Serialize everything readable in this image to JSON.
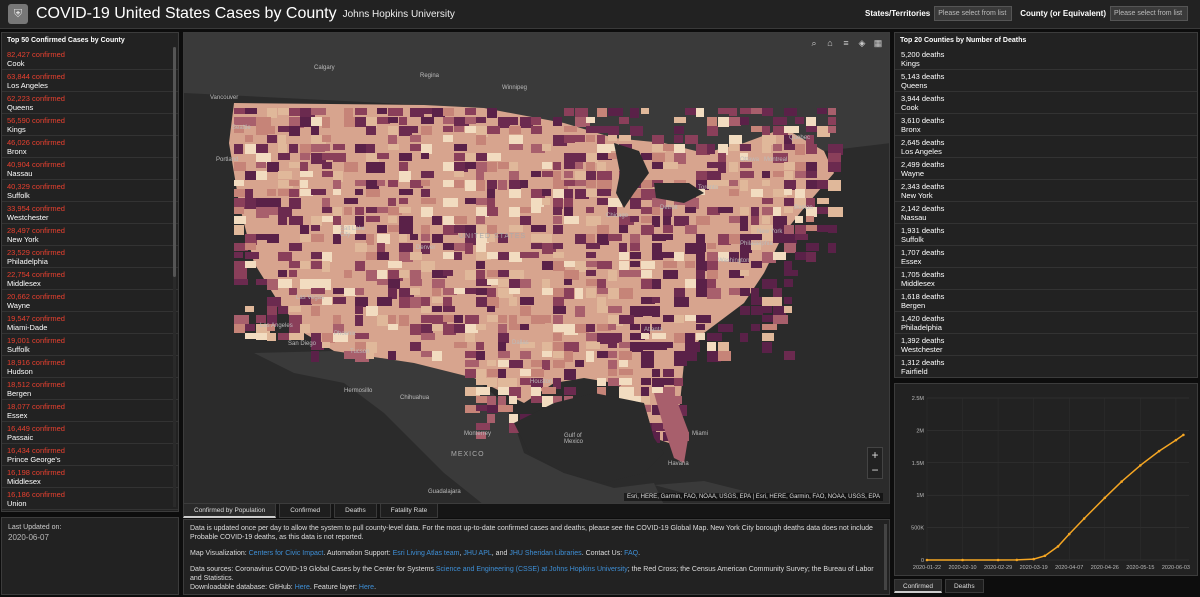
{
  "header": {
    "title": "COVID-19 United States Cases by County",
    "subtitle": "Johns Hopkins University",
    "states_label": "States/Territories",
    "states_placeholder": "Please select from list",
    "county_label": "County (or Equivalent)",
    "county_placeholder": "Please select from list"
  },
  "left_panel": {
    "heading": "Top 50 Confirmed Cases by County",
    "items": [
      {
        "value": "82,427 confirmed",
        "name": "Cook"
      },
      {
        "value": "63,844 confirmed",
        "name": "Los Angeles"
      },
      {
        "value": "62,223 confirmed",
        "name": "Queens"
      },
      {
        "value": "56,590 confirmed",
        "name": "Kings"
      },
      {
        "value": "46,026 confirmed",
        "name": "Bronx"
      },
      {
        "value": "40,904 confirmed",
        "name": "Nassau"
      },
      {
        "value": "40,329 confirmed",
        "name": "Suffolk"
      },
      {
        "value": "33,954 confirmed",
        "name": "Westchester"
      },
      {
        "value": "28,497 confirmed",
        "name": "New York"
      },
      {
        "value": "23,529 confirmed",
        "name": "Philadelphia"
      },
      {
        "value": "22,754 confirmed",
        "name": "Middlesex"
      },
      {
        "value": "20,662 confirmed",
        "name": "Wayne"
      },
      {
        "value": "19,547 confirmed",
        "name": "Miami-Dade"
      },
      {
        "value": "19,001 confirmed",
        "name": "Suffolk"
      },
      {
        "value": "18,916 confirmed",
        "name": "Hudson"
      },
      {
        "value": "18,512 confirmed",
        "name": "Bergen"
      },
      {
        "value": "18,077 confirmed",
        "name": "Essex"
      },
      {
        "value": "16,449 confirmed",
        "name": "Passaic"
      },
      {
        "value": "16,434 confirmed",
        "name": "Prince George's"
      },
      {
        "value": "16,198 confirmed",
        "name": "Middlesex"
      },
      {
        "value": "16,186 confirmed",
        "name": "Union"
      }
    ]
  },
  "last_updated": {
    "label": "Last Updated on:",
    "value": "2020-06-07"
  },
  "map": {
    "tools": [
      "search-icon",
      "home-icon",
      "list-icon",
      "layers-icon",
      "qr-icon"
    ],
    "zoom_in": "+",
    "zoom_out": "−",
    "attribution": "Esri, HERE, Garmin, FAO, NOAA, USGS, EPA | Esri, HERE, Garmin, FAO, NOAA, USGS, EPA",
    "labels": {
      "united_states": "UNITED STATES",
      "mexico": "MEXICO",
      "gulf": "Gulf of Mexico",
      "calgary": "Calgary",
      "regina": "Regina",
      "winnipeg": "Winnipeg",
      "vancouver": "Vancouver",
      "seattle": "Seattle",
      "portland": "Portland",
      "montreal": "Montreal",
      "ottawa": "Ottawa",
      "toronto": "Toronto",
      "boston": "Boston",
      "new_york": "New York",
      "chicago": "Chicago",
      "detroit": "Detroit",
      "denver": "Denver",
      "salt_lake": "Salt Lake City",
      "las_vegas": "Las Vegas",
      "los_angeles": "Los Angeles",
      "san_diego": "San Diego",
      "phoenix": "Phoenix",
      "tucson": "Tucson",
      "dallas": "Dallas",
      "houston": "Houston",
      "atlanta": "Atlanta",
      "miami": "Miami",
      "havana": "Havana",
      "monterrey": "Monterrey",
      "washington": "Washington",
      "philadelphia": "Philadelphia",
      "quebec": "Quebec",
      "hermosillo": "Hermosillo",
      "chihuahua": "Chihuahua",
      "guadalajara": "Guadalajara"
    },
    "tabs": [
      "Confirmed by Population",
      "Confirmed",
      "Deaths",
      "Fatality Rate"
    ]
  },
  "info": {
    "p1": "Data is updated once per day to allow the system to pull county-level data. For the most up-to-date confirmed cases and deaths, please see the COVID-19 Global Map. New York City borough deaths data does not include Probable COVID-19 deaths, as this data is not reported.",
    "p2_prefix": "Map Visualization: ",
    "p2_link1": "Centers for Civic Impact",
    "p2_mid1": ". Automation Support: ",
    "p2_link2": "Esri Living Atlas team",
    "p2_sep": ", ",
    "p2_link3": "JHU APL",
    "p2_mid2": ", and ",
    "p2_link4": "JHU Sheridan Libraries",
    "p2_mid3": ". Contact Us: ",
    "p2_link5": "FAQ",
    "p2_end": ".",
    "p3_prefix": "Data sources: Coronavirus COVID-19 Global Cases by the Center for Systems ",
    "p3_link": "Science and Engineering (CSSE) at Johns Hopkins University",
    "p3_rest": "; the Red Cross; the Census American Community Survey; the Bureau of Labor and Statistics.",
    "p4_prefix": "Downloadable database: GitHub: ",
    "p4_link1": "Here",
    "p4_mid": ". Feature layer: ",
    "p4_link2": "Here",
    "p4_end": "."
  },
  "right_panel": {
    "heading": "Top 20 Counties by Number of Deaths",
    "items": [
      {
        "value": "5,200 deaths",
        "name": "Kings"
      },
      {
        "value": "5,143 deaths",
        "name": "Queens"
      },
      {
        "value": "3,944 deaths",
        "name": "Cook"
      },
      {
        "value": "3,610 deaths",
        "name": "Bronx"
      },
      {
        "value": "2,645 deaths",
        "name": "Los Angeles"
      },
      {
        "value": "2,499 deaths",
        "name": "Wayne"
      },
      {
        "value": "2,343 deaths",
        "name": "New York"
      },
      {
        "value": "2,142 deaths",
        "name": "Nassau"
      },
      {
        "value": "1,931 deaths",
        "name": "Suffolk"
      },
      {
        "value": "1,707 deaths",
        "name": "Essex"
      },
      {
        "value": "1,705 deaths",
        "name": "Middlesex"
      },
      {
        "value": "1,618 deaths",
        "name": "Bergen"
      },
      {
        "value": "1,420 deaths",
        "name": "Philadelphia"
      },
      {
        "value": "1,392 deaths",
        "name": "Westchester"
      },
      {
        "value": "1,312 deaths",
        "name": "Fairfield"
      }
    ]
  },
  "chart_tabs": [
    "Confirmed",
    "Deaths"
  ],
  "colors": {
    "accent_red": "#e8402f",
    "line": "#f5a623",
    "link": "#3e8fd6"
  },
  "chart_data": {
    "type": "line",
    "title": "",
    "xlabel": "",
    "ylabel": "",
    "x_ticks": [
      "2020-01-22",
      "2020-02-10",
      "2020-02-29",
      "2020-03-19",
      "2020-04-07",
      "2020-04-26",
      "2020-05-15",
      "2020-06-03"
    ],
    "y_ticks": [
      "0",
      "500K",
      "1M",
      "1.5M",
      "2M",
      "2.5M"
    ],
    "ylim": [
      0,
      2500000
    ],
    "series": [
      {
        "name": "",
        "x": [
          "2020-01-22",
          "2020-02-10",
          "2020-02-29",
          "2020-03-10",
          "2020-03-19",
          "2020-03-25",
          "2020-04-01",
          "2020-04-07",
          "2020-04-15",
          "2020-04-26",
          "2020-05-05",
          "2020-05-15",
          "2020-05-25",
          "2020-06-03",
          "2020-06-07"
        ],
        "values": [
          0,
          0,
          100,
          1000,
          14000,
          65000,
          210000,
          400000,
          640000,
          960000,
          1210000,
          1460000,
          1680000,
          1850000,
          1930000
        ]
      }
    ]
  }
}
